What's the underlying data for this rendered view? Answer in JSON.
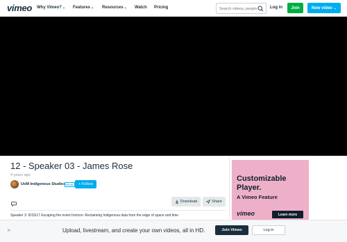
{
  "nav": {
    "logo": "vimeo",
    "items": [
      {
        "label": "Why Vimeo?",
        "caret": "⌄"
      },
      {
        "label": "Features",
        "caret": "⌄"
      },
      {
        "label": "Resources",
        "caret": "⌄"
      },
      {
        "label": "Watch",
        "caret": ""
      },
      {
        "label": "Pricing",
        "caret": ""
      }
    ],
    "search_placeholder": "Search videos, people",
    "login_label": "Log in",
    "join_label": "Join",
    "new_video_label": "New video",
    "new_video_caret": "⌄"
  },
  "video": {
    "title": "12 - Speaker 03 - James Rose",
    "age": "4 years ago",
    "channel_name": "UoM Indigenous Studies",
    "channel_badge": "PLUS",
    "follow_label": "+ Follow",
    "download_label": "Download",
    "share_label": "Share",
    "description": "Speaker 3: IDSS17 Escaping the event horizon: Reclaiming Indigenous data from the edge of space and time"
  },
  "ad": {
    "title": "Customizable Player.",
    "subtitle": "A Vimeo Feature",
    "logo": "vimeo",
    "cta": "Learn more"
  },
  "banner": {
    "close": "×",
    "text": "Upload, livestream, and create your own videos, all in HD.",
    "join_label": "Join Vimeo",
    "login_label": "Log in"
  },
  "icons": {
    "search": "search-icon",
    "comment": "comment-icon",
    "download": "download-icon",
    "share": "share-icon",
    "close": "close-icon"
  },
  "colors": {
    "brand_text": "#1a2e3b",
    "join_green": "#00ad43",
    "accent_blue": "#00adef",
    "ad_pink": "#eeb0c8",
    "player_bg": "#000000"
  }
}
